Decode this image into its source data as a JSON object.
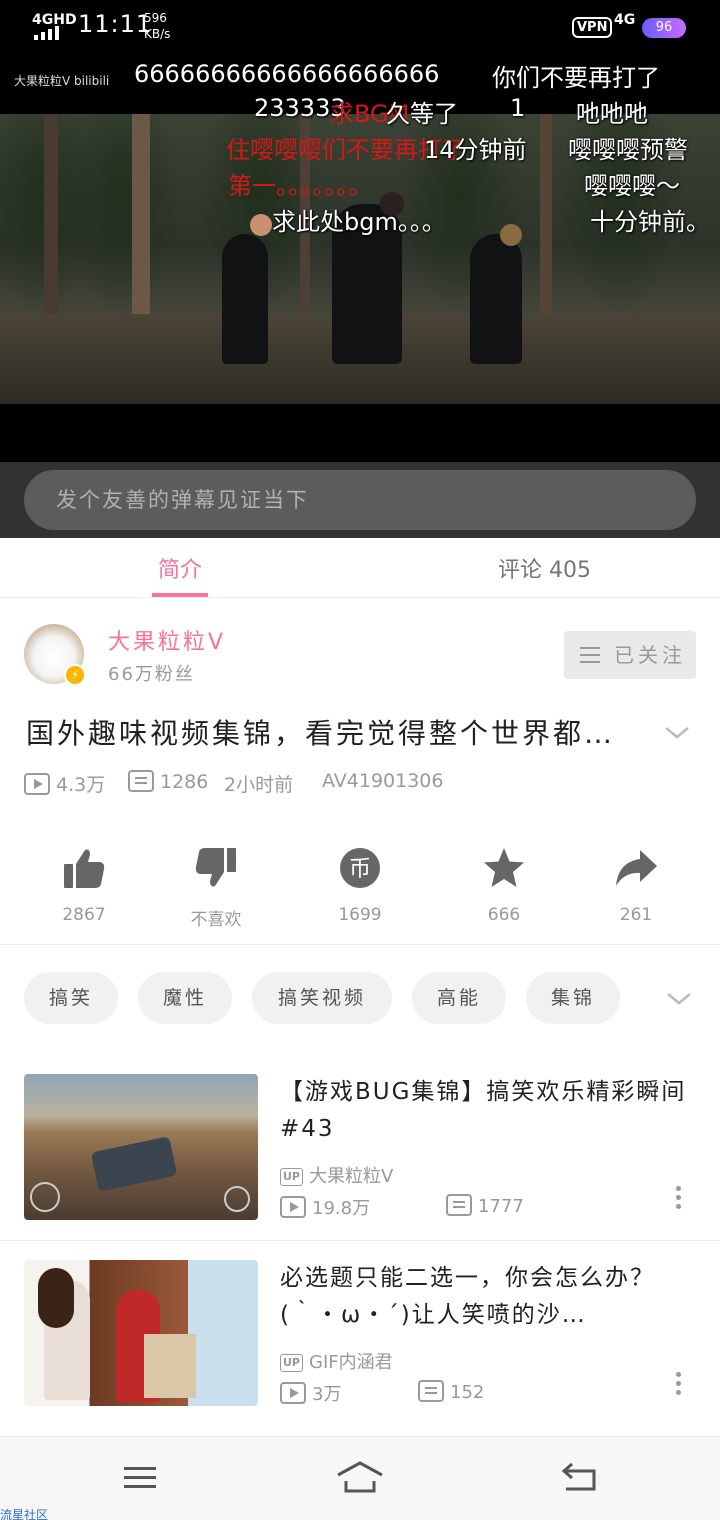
{
  "status_bar": {
    "network": "4GHD",
    "time": "11:11",
    "speed_value": "596",
    "speed_unit": "KB/s",
    "vpn": "VPN",
    "network_right": "4G",
    "battery": "96"
  },
  "player": {
    "watermark_logo": "大果粒粒V bilibili",
    "danmaku": [
      {
        "text": "66666666666666666666",
        "color": "white"
      },
      {
        "text": "你们不要再打了",
        "color": "white"
      },
      {
        "text": "233333",
        "color": "white"
      },
      {
        "text": "求BGM",
        "color": "red"
      },
      {
        "text": "久等了",
        "color": "white"
      },
      {
        "text": "1",
        "color": "white"
      },
      {
        "text": "吔吔吔",
        "color": "white"
      },
      {
        "text": "住嘤嘤嘤们不要再打了",
        "color": "red"
      },
      {
        "text": "14分钟前",
        "color": "white"
      },
      {
        "text": "嘤嘤嘤预警",
        "color": "white"
      },
      {
        "text": "第一。。。。。。。",
        "color": "red"
      },
      {
        "text": "嘤嘤嘤～",
        "color": "white"
      },
      {
        "text": "求此处bgm。。。",
        "color": "white"
      },
      {
        "text": "十分钟前。",
        "color": "white"
      }
    ]
  },
  "danmaku_input": {
    "placeholder": "发个友善的弹幕见证当下"
  },
  "tabs": [
    {
      "label": "简介",
      "active": true
    },
    {
      "label": "评论 405",
      "active": false
    }
  ],
  "uploader": {
    "name": "大果粒粒V",
    "fans": "66万粉丝",
    "follow_label": "已关注"
  },
  "video": {
    "title": "国外趣味视频集锦，看完觉得整个世界都…",
    "views": "4.3万",
    "danmaku_count": "1286",
    "time_ago": "2小时前",
    "av_id": "AV41901306"
  },
  "actions": [
    {
      "icon": "thumbs-up-icon",
      "label": "2867"
    },
    {
      "icon": "thumbs-down-icon",
      "label": "不喜欢"
    },
    {
      "icon": "coin-icon",
      "label": "1699"
    },
    {
      "icon": "star-icon",
      "label": "666"
    },
    {
      "icon": "share-icon",
      "label": "261"
    }
  ],
  "tags": [
    "搞笑",
    "魔性",
    "搞笑视频",
    "高能",
    "集锦"
  ],
  "related": [
    {
      "title": "【游戏BUG集锦】搞笑欢乐精彩瞬间 #43",
      "up_badge": "UP",
      "up_name": "大果粒粒V",
      "views": "19.8万",
      "danmaku": "1777"
    },
    {
      "title": "必选题只能二选一，你会怎么办？(｀・ω・´)让人笑喷的沙…",
      "up_badge": "UP",
      "up_name": "GIF内涵君",
      "views": "3万",
      "danmaku": "152"
    }
  ],
  "watermark": "流星社区",
  "colors": {
    "accent": "#fb7299",
    "danmaku_red": "#d21919",
    "muted": "#999999"
  }
}
